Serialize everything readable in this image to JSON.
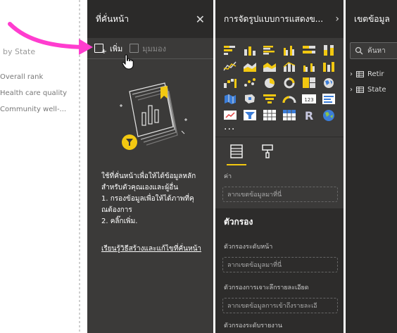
{
  "canvas": {
    "visual_title": "by State",
    "items": [
      "Overall rank",
      "Health care quality",
      "Community well-..."
    ]
  },
  "bookmarks_pane": {
    "title": "ที่คั่นหน้า",
    "add_label": "เพิ่ม",
    "view_label": "มุมมอง",
    "desc_lines": [
      "ใช้ที่คั่นหน้าเพื่อให้ได้ข้อมูลหลัก",
      "สำหรับตัวคุณเองและผู้อื่น",
      "1. กรองข้อมูลเพื่อให้ได้ภาพที่คุ",
      "ณต้องการ",
      "2. คลิ๊กเพิ่ม."
    ],
    "link_text": "เรียนรู้วิธีสร้างและแก้ไขที่คั่นหน้า"
  },
  "viz_pane": {
    "title": "การจัดรูปแบบการแสดงข...",
    "more": "...",
    "values_label": "ค่า",
    "values_placeholder": "ลากเขตข้อมูลมาที่นี่",
    "filters_title": "ตัวกรอง",
    "page_filter_label": "ตัวกรองระดับหน้า",
    "page_filter_placeholder": "ลากเขตข้อมูลมาที่นี่",
    "drill_filter_label": "ตัวกรองการเจาะลึกรายละเอียด",
    "drill_filter_placeholder": "ลากเขตข้อมูลการเข้าถึงรายละเอี",
    "report_filter_label": "ตัวกรองระดับรายงาน"
  },
  "fields_pane": {
    "title": "เขตข้อมูล",
    "search_placeholder": "ค้นหา",
    "tables": [
      "Retir",
      "State"
    ]
  },
  "colors": {
    "pink_arrow": "#ff3dcf",
    "accent_yellow": "#f2c811"
  }
}
